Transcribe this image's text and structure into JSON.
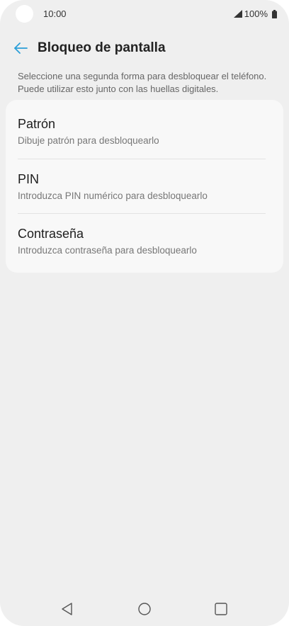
{
  "status_bar": {
    "time": "10:00",
    "battery": "100%"
  },
  "header": {
    "title": "Bloqueo de pantalla"
  },
  "description": "Seleccione una segunda forma para desbloquear el teléfono. Puede utilizar esto junto con las huellas digitales.",
  "options": [
    {
      "title": "Patrón",
      "subtitle": "Dibuje patrón para desbloquearlo"
    },
    {
      "title": "PIN",
      "subtitle": "Introduzca PIN numérico para desbloquearlo"
    },
    {
      "title": "Contraseña",
      "subtitle": "Introduzca contraseña para desbloquearlo"
    }
  ],
  "icons": {
    "back": "arrow-left-icon",
    "signal": "signal-icon",
    "battery": "battery-icon",
    "nav_back": "triangle-back-icon",
    "nav_home": "circle-home-icon",
    "nav_recents": "square-recents-icon"
  },
  "colors": {
    "accent": "#2a9fd8",
    "background": "#efefef",
    "card": "#f8f8f8"
  }
}
